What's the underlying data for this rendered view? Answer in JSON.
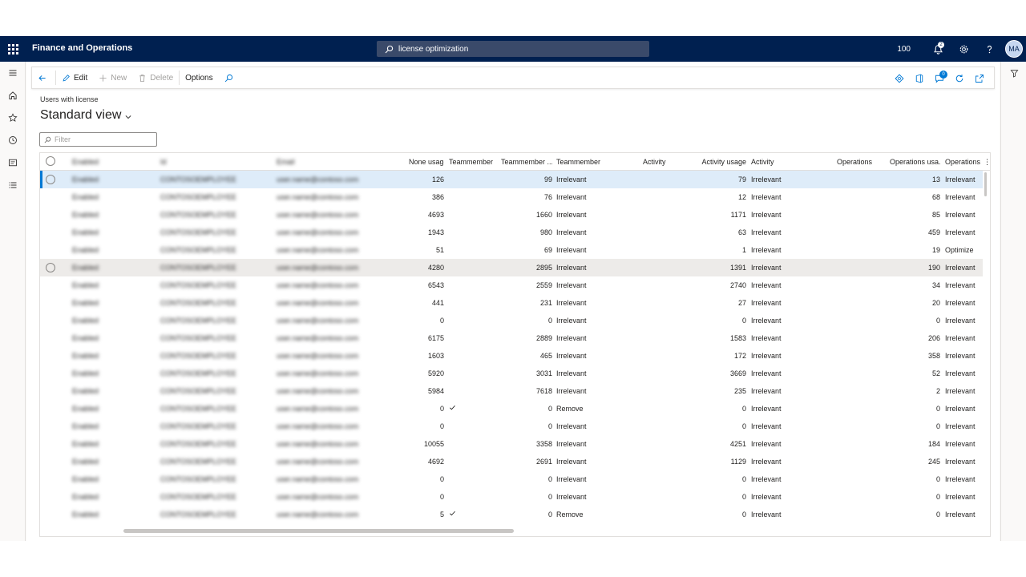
{
  "app": {
    "title": "Finance and Operations",
    "search_value": "license optimization",
    "company": "100",
    "notification_count": "2",
    "user_initials": "MA"
  },
  "actions": {
    "edit": "Edit",
    "new": "New",
    "delete": "Delete",
    "options": "Options",
    "attachments_count": "0"
  },
  "page": {
    "caption": "Users with license",
    "view_title": "Standard view",
    "filter_placeholder": "Filter"
  },
  "grid": {
    "columns": [
      "Enabled",
      "Id",
      "Email",
      "None usage",
      "Teammember",
      "Teammember ...",
      "Teammember",
      "Activity",
      "Activity usage",
      "Activity",
      "Operations",
      "Operations usa...",
      "Operations"
    ],
    "rows": [
      {
        "user": "Enabled",
        "id": "CONTOSOEMPLOYEE",
        "email": "user.name@contoso.com",
        "none": "126",
        "tm_check": false,
        "tm_usage": "99",
        "tm_status": "Irrelevant",
        "act_usage": "79",
        "act_status": "Irrelevant",
        "ops_usage": "13",
        "ops_status": "Irrelevant"
      },
      {
        "user": "Enabled",
        "id": "CONTOSOEMPLOYEE",
        "email": "user.name@contoso.com",
        "none": "386",
        "tm_check": false,
        "tm_usage": "76",
        "tm_status": "Irrelevant",
        "act_usage": "12",
        "act_status": "Irrelevant",
        "ops_usage": "68",
        "ops_status": "Irrelevant"
      },
      {
        "user": "Enabled",
        "id": "CONTOSOEMPLOYEE",
        "email": "user.name@contoso.com",
        "none": "4693",
        "tm_check": false,
        "tm_usage": "1660",
        "tm_status": "Irrelevant",
        "act_usage": "1171",
        "act_status": "Irrelevant",
        "ops_usage": "85",
        "ops_status": "Irrelevant"
      },
      {
        "user": "Enabled",
        "id": "CONTOSOEMPLOYEE",
        "email": "user.name@contoso.com",
        "none": "1943",
        "tm_check": false,
        "tm_usage": "980",
        "tm_status": "Irrelevant",
        "act_usage": "63",
        "act_status": "Irrelevant",
        "ops_usage": "459",
        "ops_status": "Irrelevant"
      },
      {
        "user": "Enabled",
        "id": "CONTOSOEMPLOYEE",
        "email": "user.name@contoso.com",
        "none": "51",
        "tm_check": false,
        "tm_usage": "69",
        "tm_status": "Irrelevant",
        "act_usage": "1",
        "act_status": "Irrelevant",
        "ops_usage": "19",
        "ops_status": "Optimize"
      },
      {
        "user": "Enabled",
        "id": "CONTOSOEMPLOYEE",
        "email": "user.name@contoso.com",
        "none": "4280",
        "tm_check": false,
        "tm_usage": "2895",
        "tm_status": "Irrelevant",
        "act_usage": "1391",
        "act_status": "Irrelevant",
        "ops_usage": "190",
        "ops_status": "Irrelevant"
      },
      {
        "user": "Enabled",
        "id": "CONTOSOEMPLOYEE",
        "email": "user.name@contoso.com",
        "none": "6543",
        "tm_check": false,
        "tm_usage": "2559",
        "tm_status": "Irrelevant",
        "act_usage": "2740",
        "act_status": "Irrelevant",
        "ops_usage": "34",
        "ops_status": "Irrelevant"
      },
      {
        "user": "Enabled",
        "id": "CONTOSOEMPLOYEE",
        "email": "user.name@contoso.com",
        "none": "441",
        "tm_check": false,
        "tm_usage": "231",
        "tm_status": "Irrelevant",
        "act_usage": "27",
        "act_status": "Irrelevant",
        "ops_usage": "20",
        "ops_status": "Irrelevant"
      },
      {
        "user": "Enabled",
        "id": "CONTOSOEMPLOYEE",
        "email": "user.name@contoso.com",
        "none": "0",
        "tm_check": false,
        "tm_usage": "0",
        "tm_status": "Irrelevant",
        "act_usage": "0",
        "act_status": "Irrelevant",
        "ops_usage": "0",
        "ops_status": "Irrelevant"
      },
      {
        "user": "Enabled",
        "id": "CONTOSOEMPLOYEE",
        "email": "user.name@contoso.com",
        "none": "6175",
        "tm_check": false,
        "tm_usage": "2889",
        "tm_status": "Irrelevant",
        "act_usage": "1583",
        "act_status": "Irrelevant",
        "ops_usage": "206",
        "ops_status": "Irrelevant"
      },
      {
        "user": "Enabled",
        "id": "CONTOSOEMPLOYEE",
        "email": "user.name@contoso.com",
        "none": "1603",
        "tm_check": false,
        "tm_usage": "465",
        "tm_status": "Irrelevant",
        "act_usage": "172",
        "act_status": "Irrelevant",
        "ops_usage": "358",
        "ops_status": "Irrelevant"
      },
      {
        "user": "Enabled",
        "id": "CONTOSOEMPLOYEE",
        "email": "user.name@contoso.com",
        "none": "5920",
        "tm_check": false,
        "tm_usage": "3031",
        "tm_status": "Irrelevant",
        "act_usage": "3669",
        "act_status": "Irrelevant",
        "ops_usage": "52",
        "ops_status": "Irrelevant"
      },
      {
        "user": "Enabled",
        "id": "CONTOSOEMPLOYEE",
        "email": "user.name@contoso.com",
        "none": "5984",
        "tm_check": false,
        "tm_usage": "7618",
        "tm_status": "Irrelevant",
        "act_usage": "235",
        "act_status": "Irrelevant",
        "ops_usage": "2",
        "ops_status": "Irrelevant"
      },
      {
        "user": "Enabled",
        "id": "CONTOSOEMPLOYEE",
        "email": "user.name@contoso.com",
        "none": "0",
        "tm_check": true,
        "tm_usage": "0",
        "tm_status": "Remove",
        "act_usage": "0",
        "act_status": "Irrelevant",
        "ops_usage": "0",
        "ops_status": "Irrelevant"
      },
      {
        "user": "Enabled",
        "id": "CONTOSOEMPLOYEE",
        "email": "user.name@contoso.com",
        "none": "0",
        "tm_check": false,
        "tm_usage": "0",
        "tm_status": "Irrelevant",
        "act_usage": "0",
        "act_status": "Irrelevant",
        "ops_usage": "0",
        "ops_status": "Irrelevant"
      },
      {
        "user": "Enabled",
        "id": "CONTOSOEMPLOYEE",
        "email": "user.name@contoso.com",
        "none": "10055",
        "tm_check": false,
        "tm_usage": "3358",
        "tm_status": "Irrelevant",
        "act_usage": "4251",
        "act_status": "Irrelevant",
        "ops_usage": "184",
        "ops_status": "Irrelevant"
      },
      {
        "user": "Enabled",
        "id": "CONTOSOEMPLOYEE",
        "email": "user.name@contoso.com",
        "none": "4692",
        "tm_check": false,
        "tm_usage": "2691",
        "tm_status": "Irrelevant",
        "act_usage": "1129",
        "act_status": "Irrelevant",
        "ops_usage": "245",
        "ops_status": "Irrelevant"
      },
      {
        "user": "Enabled",
        "id": "CONTOSOEMPLOYEE",
        "email": "user.name@contoso.com",
        "none": "0",
        "tm_check": false,
        "tm_usage": "0",
        "tm_status": "Irrelevant",
        "act_usage": "0",
        "act_status": "Irrelevant",
        "ops_usage": "0",
        "ops_status": "Irrelevant"
      },
      {
        "user": "Enabled",
        "id": "CONTOSOEMPLOYEE",
        "email": "user.name@contoso.com",
        "none": "0",
        "tm_check": false,
        "tm_usage": "0",
        "tm_status": "Irrelevant",
        "act_usage": "0",
        "act_status": "Irrelevant",
        "ops_usage": "0",
        "ops_status": "Irrelevant"
      },
      {
        "user": "Enabled",
        "id": "CONTOSOEMPLOYEE",
        "email": "user.name@contoso.com",
        "none": "5",
        "tm_check": true,
        "tm_usage": "0",
        "tm_status": "Remove",
        "act_usage": "0",
        "act_status": "Irrelevant",
        "ops_usage": "0",
        "ops_status": "Irrelevant"
      }
    ]
  },
  "colors": {
    "nav_bar": "#002050",
    "selected_row": "#deecf9",
    "accent": "#0078d4"
  }
}
